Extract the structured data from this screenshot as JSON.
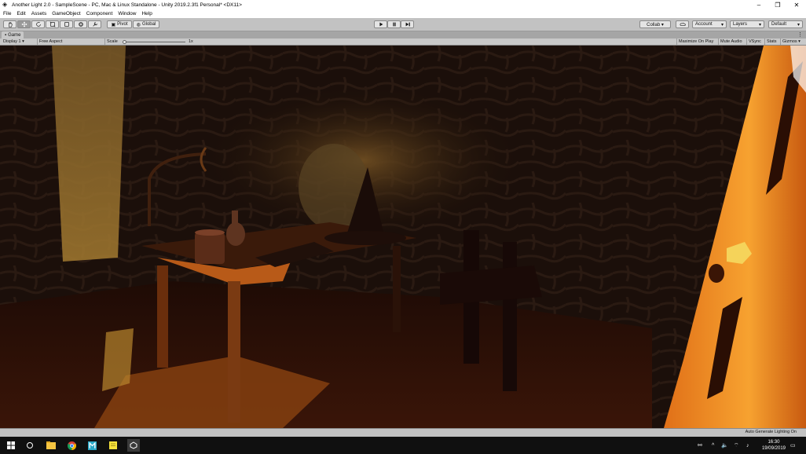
{
  "window": {
    "title": "Another Light 2.0 - SampleScene - PC, Mac & Linux Standalone - Unity 2019.2.3f1 Personal* <DX11>",
    "minimize": "–",
    "maximize": "❐",
    "close": "✕"
  },
  "menu": [
    "File",
    "Edit",
    "Assets",
    "GameObject",
    "Component",
    "Window",
    "Help"
  ],
  "toolbar": {
    "pivot_label": "Pivot",
    "global_label": "Global",
    "collab_label": "Collab ▾",
    "account_label": "Account",
    "layers_label": "Layers",
    "layout_label": "Default"
  },
  "game_view": {
    "tab_label": "Game",
    "display": "Display 1",
    "aspect": "Free Aspect",
    "scale_label": "Scale",
    "scale_value": "1x",
    "maximize_on_play": "Maximize On Play",
    "mute_audio": "Mute Audio",
    "vsync": "VSync",
    "stats": "Stats",
    "gizmos": "Gizmos"
  },
  "status": {
    "message": "Auto Generate Lighting On"
  },
  "taskbar": {
    "time": "16:30",
    "date": "19/09/2019"
  },
  "colors": {
    "editor_gray": "#c2c2c2",
    "light_orange": "#f08a20",
    "shadow_brown": "#1a0a05"
  }
}
